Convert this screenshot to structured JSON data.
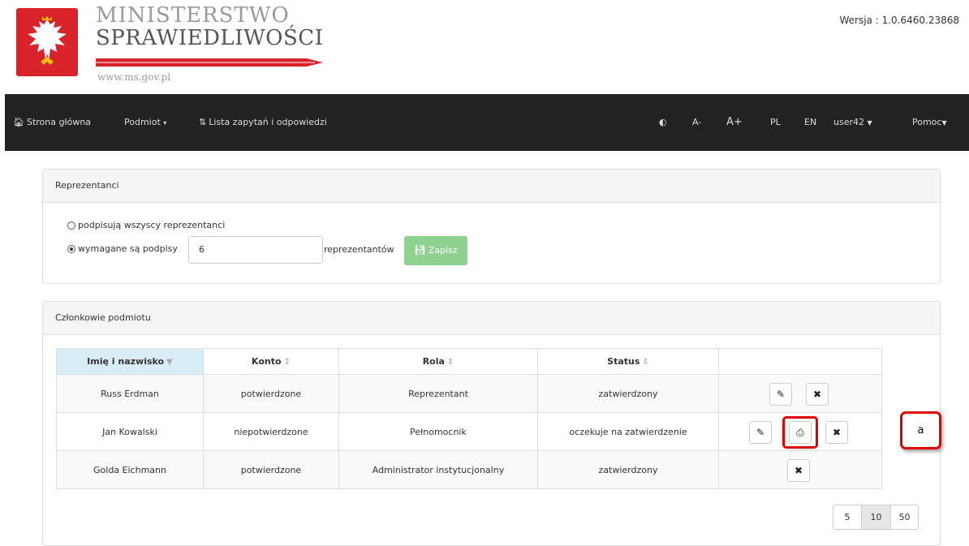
{
  "header": {
    "brand_line1": "MINISTERSTWO",
    "brand_line2": "SPRAWIEDLIWOŚCI",
    "brand_url": "www.ms.gov.pl",
    "version": "Wersja : 1.0.6460.23868"
  },
  "navbar": {
    "home": "Strona główna",
    "entity": "Podmiot",
    "requests": "Lista zapytań i odpowiedzi",
    "font_small": "A-",
    "font_large": "A+",
    "lang_pl": "PL",
    "lang_en": "EN",
    "user": "user42",
    "help": "Pomoc"
  },
  "representatives": {
    "title": "Reprezentanci",
    "option_all": "podpisują wszyscy reprezentanci",
    "option_required": "wymagane są podpisy",
    "required_count": "6",
    "suffix": "reprezentantów",
    "save_label": "Zapisz"
  },
  "members": {
    "title": "Członkowie podmiotu",
    "columns": [
      "Imię i nazwisko",
      "Konto",
      "Rola",
      "Status"
    ],
    "rows": [
      {
        "name": "Russ Erdman",
        "account": "potwierdzone",
        "role": "Reprezentant",
        "status": "zatwierdzony"
      },
      {
        "name": "Jan Kowalski",
        "account": "niepotwierdzone",
        "role": "Pełnomocnik",
        "status": "oczekuje na zatwierdzenie"
      },
      {
        "name": "Golda Eichmann",
        "account": "potwierdzone",
        "role": "Administrator instytucjonalny",
        "status": "zatwierdzony"
      }
    ]
  },
  "pagination": {
    "sizes": [
      "5",
      "10",
      "50"
    ],
    "active": "10"
  },
  "callout": {
    "label": "a"
  },
  "colors": {
    "navbar": "#222222",
    "emblem": "#d8232a",
    "save_button": "#8fd18f",
    "highlight": "#e00000"
  }
}
